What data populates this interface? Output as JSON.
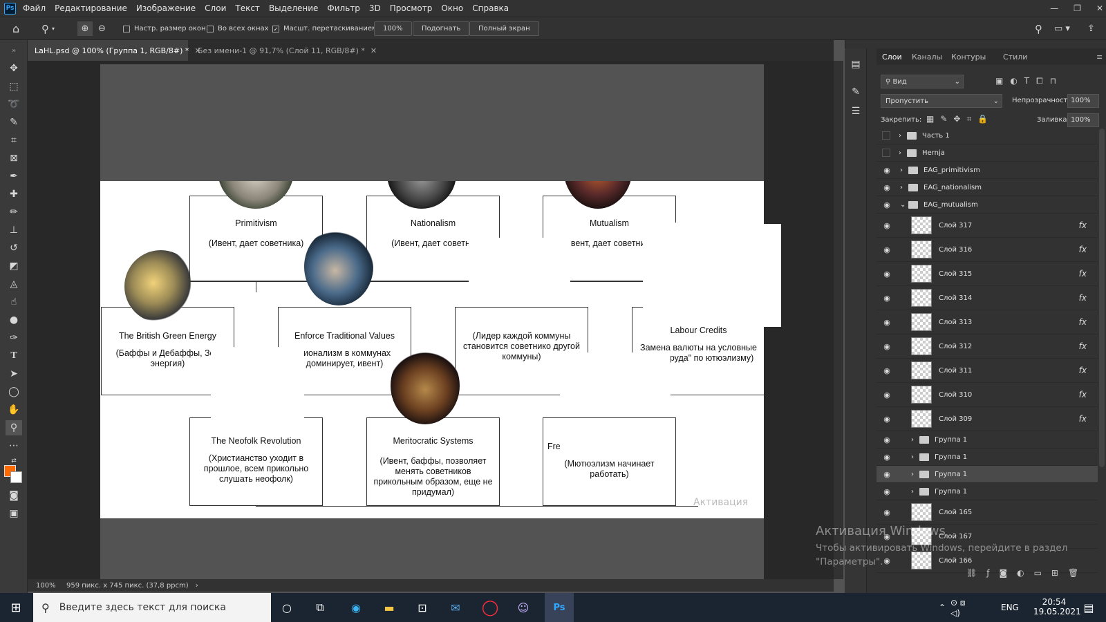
{
  "app": {
    "logo": "Ps"
  },
  "menu": [
    "Файл",
    "Редактирование",
    "Изображение",
    "Слои",
    "Текст",
    "Выделение",
    "Фильтр",
    "3D",
    "Просмотр",
    "Окно",
    "Справка"
  ],
  "window_controls": [
    "—",
    "❐",
    "✕"
  ],
  "options": {
    "resize_windows": "Настр. размер окон",
    "all_windows": "Во всех окнах",
    "scrubby_zoom": "Масшт. перетаскиванием",
    "zoom_value": "100%",
    "fit": "Подогнать",
    "fullscreen": "Полный экран"
  },
  "tabs": [
    {
      "label": "LaHL.psd @ 100% (Группа 1, RGB/8#) *",
      "active": true
    },
    {
      "label": "Без имени-1 @ 91,7% (Слой 11, RGB/8#) *",
      "active": false
    }
  ],
  "doc": {
    "nodes": [
      {
        "title": "Primitivism",
        "desc": "(Ивент, дает советника)"
      },
      {
        "title": "Nationalism",
        "desc": "(Ивент, дает советни"
      },
      {
        "title": "Mutualism",
        "desc": "Ивент, дает советника"
      },
      {
        "title": "The British Green Energy",
        "desc": "(Баффы и Дебаффы, Зел энергия)"
      },
      {
        "title": "Enforce Traditional Values",
        "desc": "ционализм в коммунах доминирует, ивент)"
      },
      {
        "title": "",
        "desc": "(Лидер каждой коммуны становится советнико другой коммуны)"
      },
      {
        "title": "Labour Credits",
        "desc": "Замена валюты на условные диты труда\" по ютюэлизму)"
      },
      {
        "title": "The Neofolk Revolution",
        "desc": "(Христианство уходит в прошлое, всем прикольно слушать неофолк)"
      },
      {
        "title": "Meritocratic Systems",
        "desc": "(Ивент, баффы, позволяет менять советников прикольным образом, еще не придумал)"
      },
      {
        "title": "Fre",
        "desc": "(Мютюэлизм начинает работать)"
      }
    ],
    "activation_overlay": "Активация"
  },
  "status": {
    "zoom": "100%",
    "doc_size": "959 пикс. x 745 пикс. (37,8 ppcm)"
  },
  "layers_panel": {
    "tabs": [
      "Слои",
      "Каналы",
      "Контуры",
      "Стили"
    ],
    "filter_label": "Вид",
    "blend_mode": "Пропустить",
    "opacity_label": "Непрозрачность:",
    "opacity": "100%",
    "lock_label": "Закрепить:",
    "fill_label": "Заливка:",
    "fill": "100%",
    "layers": [
      {
        "name": "Часть 1",
        "type": "group",
        "visible": false
      },
      {
        "name": "Hernja",
        "type": "group",
        "visible": false
      },
      {
        "name": "EAG_primitivism",
        "type": "group",
        "visible": true
      },
      {
        "name": "EAG_nationalism",
        "type": "group",
        "visible": true
      },
      {
        "name": "EAG_mutualism",
        "type": "group-open",
        "visible": true
      },
      {
        "name": "Слой 317",
        "type": "layer",
        "fx": "fx"
      },
      {
        "name": "Слой 316",
        "type": "layer",
        "fx": "fx"
      },
      {
        "name": "Слой 315",
        "type": "layer",
        "fx": "fx"
      },
      {
        "name": "Слой 314",
        "type": "layer",
        "fx": "fx"
      },
      {
        "name": "Слой 313",
        "type": "layer",
        "fx": "fx"
      },
      {
        "name": "Слой 312",
        "type": "layer",
        "fx": "fx"
      },
      {
        "name": "Слой 311",
        "type": "layer",
        "fx": "fx"
      },
      {
        "name": "Слой 310",
        "type": "layer",
        "fx": "fx"
      },
      {
        "name": "Слой 309",
        "type": "layer",
        "fx": "fx"
      },
      {
        "name": "Группа 1",
        "type": "subgroup"
      },
      {
        "name": "Группа 1",
        "type": "subgroup"
      },
      {
        "name": "Группа 1",
        "type": "subgroup",
        "selected": true
      },
      {
        "name": "Группа 1",
        "type": "subgroup"
      },
      {
        "name": "Слой 165",
        "type": "layer"
      },
      {
        "name": "Слой 167",
        "type": "layer"
      },
      {
        "name": "Слой 166",
        "type": "layer"
      }
    ]
  },
  "taskbar": {
    "search_placeholder": "Введите здесь текст для поиска",
    "lang": "ENG",
    "time": "20:54",
    "date": "19.05.2021"
  },
  "watermark": {
    "title": "Активация Windows",
    "line1": "Чтобы активировать Windows, перейдите в раздел",
    "line2": "\"Параметры\"."
  },
  "colors": {
    "foreground": "#ff6a00",
    "background": "#ffffff",
    "accent": "#31a8ff"
  }
}
